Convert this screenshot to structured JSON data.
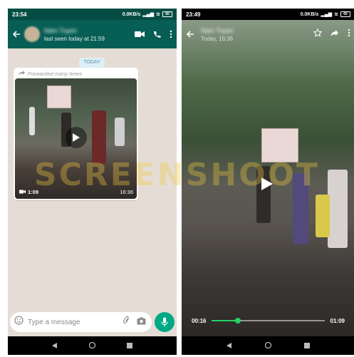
{
  "left": {
    "status_time": "23:54",
    "status_speed": "0.0KB/s",
    "battery": "60",
    "contact_name": "Nam Tuyen",
    "last_seen": "last seen today at 21:59",
    "date_chip": "TODAY",
    "forwarded_label": "Forwarded many times",
    "video_duration": "1:09",
    "message_time": "16:36",
    "input_placeholder": "Type a message",
    "colors": {
      "header": "#075e54",
      "status": "#054d44",
      "mic": "#00a884",
      "chat_bg": "#e5ddd5"
    }
  },
  "right": {
    "status_time": "23:49",
    "status_speed": "0.0KB/s",
    "battery": "60",
    "contact_name": "Nam Tuyen",
    "date": "Today, 16:36",
    "current_time": "00:16",
    "total_time": "01:09",
    "progress": 0.23,
    "colors": {
      "seek": "#25d366"
    }
  },
  "watermark": "SCREENSHOOT"
}
